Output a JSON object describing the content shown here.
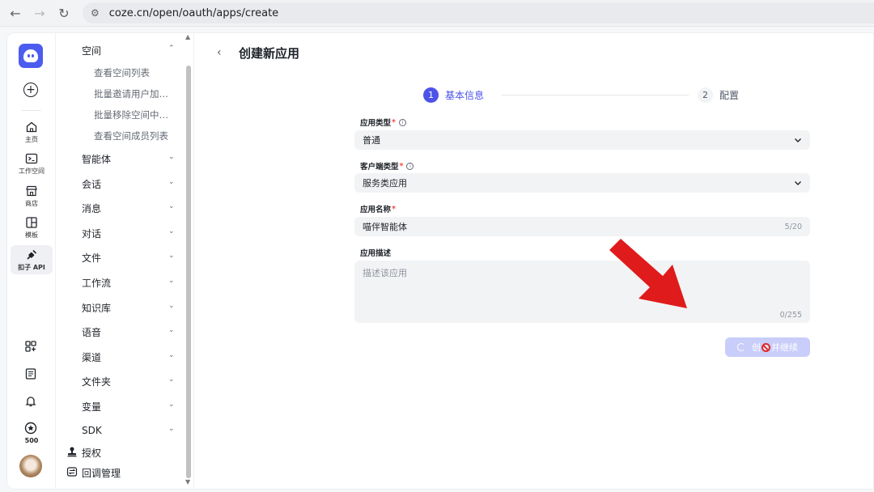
{
  "browser": {
    "url": "coze.cn/open/oauth/apps/create"
  },
  "rail": {
    "items": [
      {
        "label": "主页"
      },
      {
        "label": "工作空间"
      },
      {
        "label": "商店"
      },
      {
        "label": "模板"
      },
      {
        "label": "扣子 API"
      }
    ],
    "points_badge": "500"
  },
  "menu": {
    "space_header": "空间",
    "space_children": [
      "查看空间列表",
      "批量邀请用户加…",
      "批量移除空间中…",
      "查看空间成员列表"
    ],
    "sections": [
      "智能体",
      "会话",
      "消息",
      "对话",
      "文件",
      "工作流",
      "知识库",
      "语音",
      "渠道",
      "文件夹",
      "变量",
      "SDK"
    ],
    "auth": "授权",
    "callback": "回调管理"
  },
  "page": {
    "back_icon": "chevron-left-icon",
    "title": "创建新应用",
    "steps": [
      {
        "num": "1",
        "label": "基本信息",
        "active": true
      },
      {
        "num": "2",
        "label": "配置",
        "active": false
      }
    ],
    "form": {
      "app_type": {
        "label": "应用类型",
        "required": "*",
        "value": "普通"
      },
      "client_type": {
        "label": "客户端类型",
        "required": "*",
        "value": "服务类应用"
      },
      "app_name": {
        "label": "应用名称",
        "required": "*",
        "value": "喵伴智能体",
        "counter": "5/20"
      },
      "app_desc": {
        "label": "应用描述",
        "placeholder": "描述该应用",
        "counter": "0/255"
      }
    },
    "submit_label_left": "创",
    "submit_label_right": "并继续"
  },
  "colors": {
    "accent": "#4d53e8",
    "annotation_arrow": "#e01b1b"
  }
}
